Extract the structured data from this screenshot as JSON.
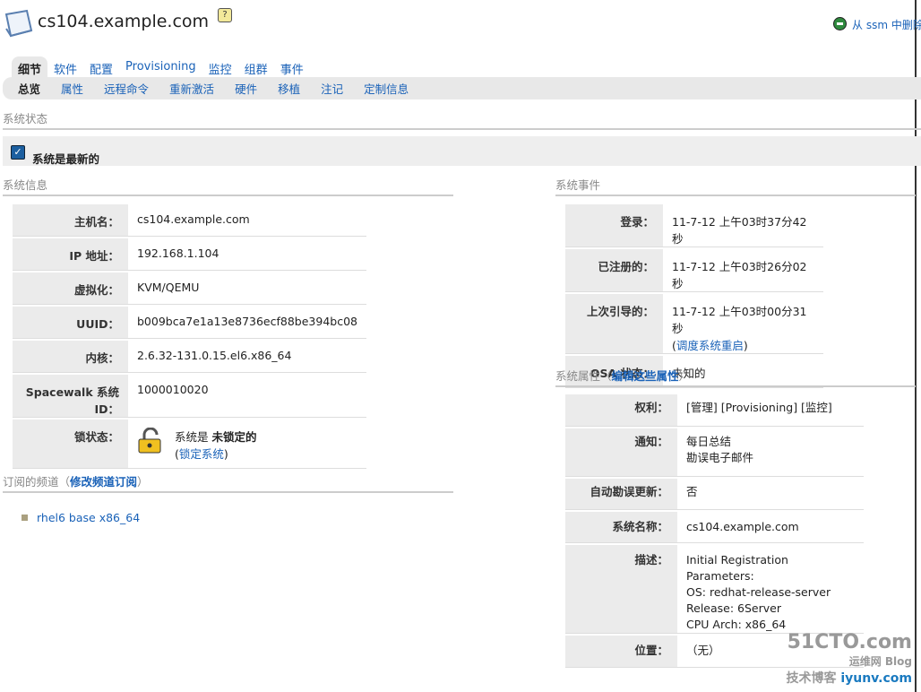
{
  "header": {
    "title": "cs104.example.com",
    "help": "?",
    "delete_label": "从 ssm 中删除"
  },
  "tabs": [
    "细节",
    "软件",
    "配置",
    "Provisioning",
    "监控",
    "组群",
    "事件"
  ],
  "subtabs": [
    "总览",
    "属性",
    "远程命令",
    "重新激活",
    "硬件",
    "移植",
    "注记",
    "定制信息"
  ],
  "status": {
    "heading": "系统状态",
    "message": "系统是最新的"
  },
  "info": {
    "heading": "系统信息",
    "rows": [
      {
        "label": "主机名：",
        "value": "cs104.example.com"
      },
      {
        "label": "IP 地址：",
        "value": "192.168.1.104"
      },
      {
        "label": "虚拟化：",
        "value": "KVM/QEMU"
      },
      {
        "label": "UUID：",
        "value": "b009bca7e1a13e8736ecf88be394bc08"
      },
      {
        "label": "内核：",
        "value": "2.6.32-131.0.15.el6.x86_64"
      },
      {
        "label": "Spacewalk 系统 ID：",
        "value": "1000010020"
      }
    ],
    "lock_label": "锁状态：",
    "lock_prefix": "系统是 ",
    "lock_state": "未锁定的",
    "lock_link": "锁定系统"
  },
  "channels": {
    "heading": "订阅的频道（",
    "heading_end": "）",
    "edit_link": "修改频道订阅",
    "items": [
      "rhel6 base x86_64"
    ]
  },
  "events": {
    "heading": "系统事件",
    "rows": [
      {
        "label": "登录：",
        "value": "11-7-12 上午03时37分42秒"
      },
      {
        "label": "已注册的：",
        "value": "11-7-12 上午03时26分02秒"
      },
      {
        "label": "上次引导的：",
        "value": "11-7-12 上午03时00分31秒",
        "link": "调度系统重启"
      },
      {
        "label": "OSA 状态：",
        "value": "未知的"
      }
    ]
  },
  "props": {
    "heading": "系统属性（",
    "heading_end": "）",
    "edit_link": "编辑这些属性",
    "rows": [
      {
        "label": "权利：",
        "lines": [
          "[管理] [Provisioning] [监控]"
        ]
      },
      {
        "label": "通知：",
        "lines": [
          "每日总结",
          "勘误电子邮件"
        ]
      },
      {
        "label": "自动勘误更新：",
        "lines": [
          "否"
        ]
      },
      {
        "label": "系统名称：",
        "lines": [
          "cs104.example.com"
        ]
      },
      {
        "label": "描述：",
        "lines": [
          "Initial Registration Parameters:",
          "OS: redhat-release-server",
          "Release: 6Server",
          "CPU Arch: x86_64"
        ]
      },
      {
        "label": "位置：",
        "lines": [
          "（无）"
        ]
      }
    ]
  },
  "watermark": {
    "line1": "51CTO.com",
    "line2": "技术博客",
    "line3": "运维网 Blog",
    "line4": "iyunv.com"
  }
}
